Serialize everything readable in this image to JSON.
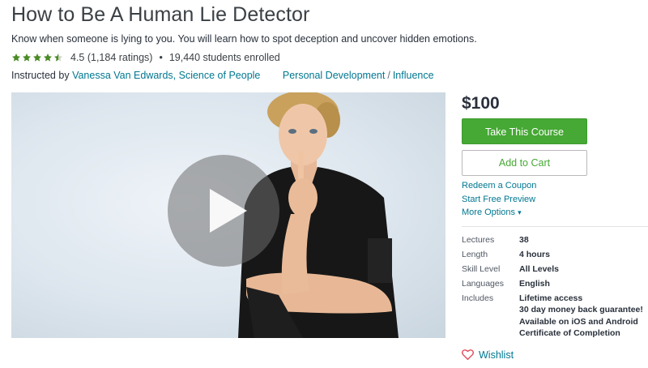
{
  "course": {
    "title": "How to Be A Human Lie Detector",
    "subtitle": "Know when someone is lying to you. You will learn how to spot deception and uncover hidden emotions.",
    "rating_value": 4.5,
    "rating_text": "4.5 (1,184 ratings)",
    "separator": "•",
    "students": "19,440 students enrolled",
    "instructed_by_label": "Instructed by",
    "instructor_link": "Vanessa Van Edwards, Science of People",
    "category": "Personal Development",
    "category_separator": "/",
    "subcategory": "Influence"
  },
  "video": {
    "play_icon": "play-icon"
  },
  "sidebar": {
    "price": "$100",
    "take_course_label": "Take This Course",
    "add_to_cart_label": "Add to Cart",
    "redeem_coupon_label": "Redeem a Coupon",
    "free_preview_label": "Start Free Preview",
    "more_options_label": "More Options",
    "more_options_caret": "▾",
    "specs": [
      {
        "key": "Lectures",
        "value": "38"
      },
      {
        "key": "Length",
        "value": "4 hours"
      },
      {
        "key": "Skill Level",
        "value": "All Levels"
      },
      {
        "key": "Languages",
        "value": "English"
      }
    ],
    "includes_label": "Includes",
    "includes": [
      "Lifetime access",
      "30 day money back guarantee!",
      "Available on iOS and Android",
      "Certificate of Completion"
    ],
    "wishlist_label": "Wishlist"
  },
  "colors": {
    "accent_green": "#46a835",
    "link_blue": "#007791",
    "star_green": "#4b8a26"
  }
}
